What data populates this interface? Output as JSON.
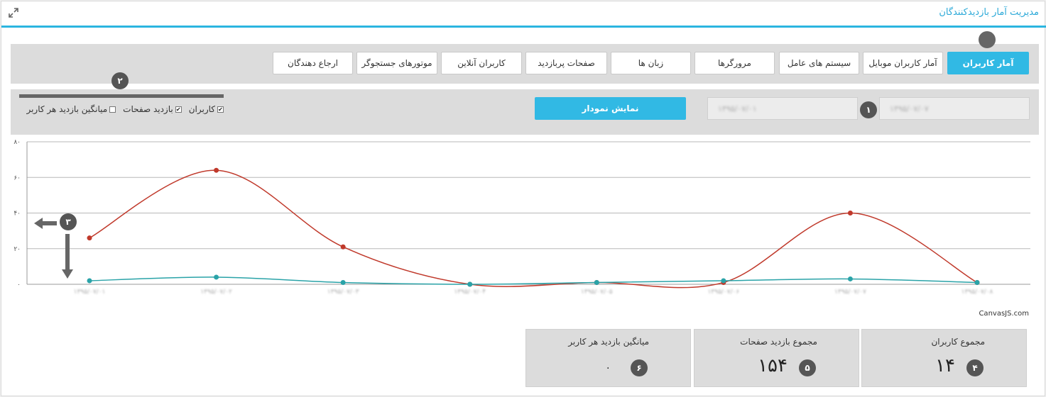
{
  "header": {
    "title": "مدیریت آمار بازدیدکنندگان"
  },
  "tabs": [
    {
      "label": "آمار کاربران",
      "active": true
    },
    {
      "label": "آمار کاربران موبایل",
      "active": false
    },
    {
      "label": "سیستم های عامل",
      "active": false
    },
    {
      "label": "مرورگرها",
      "active": false
    },
    {
      "label": "زبان ها",
      "active": false
    },
    {
      "label": "صفحات پربازدید",
      "active": false
    },
    {
      "label": "کاربران آنلاین",
      "active": false
    },
    {
      "label": "موتورهای جستجوگر",
      "active": false
    },
    {
      "label": "ارجاع دهندگان",
      "active": false
    }
  ],
  "filters": {
    "date_from": "۱۳۹۵/۰۷/۰۷",
    "date_to": "۱۳۹۵/۰۷/۰۱",
    "show_button": "نمایش نمودار",
    "checkboxes": [
      {
        "label": "کاربران",
        "checked": true
      },
      {
        "label": "بازدید صفحات",
        "checked": true
      },
      {
        "label": "میانگین بازدید هر کاربر",
        "checked": false
      }
    ]
  },
  "badges": {
    "b1": "۱",
    "b2": "۲",
    "b3": "۳",
    "b4": "۴",
    "b5": "۵",
    "b6": "۶"
  },
  "chart_data": {
    "type": "line",
    "ylim": [
      0,
      80
    ],
    "y_ticks": [
      "۰",
      "۲۰",
      "۴۰",
      "۶۰",
      "۸۰"
    ],
    "categories": [
      "۱۳۹۵/۰۷/۰۱",
      "۱۳۹۵/۰۷/۰۲",
      "۱۳۹۵/۰۷/۰۳",
      "۱۳۹۵/۰۷/۰۴",
      "۱۳۹۵/۰۷/۰۵",
      "۱۳۹۵/۰۷/۰۶",
      "۱۳۹۵/۰۷/۰۷",
      "۱۳۹۵/۰۷/۰۸"
    ],
    "series": [
      {
        "color": "#c0392b",
        "values": [
          26,
          64,
          21,
          0,
          1,
          1,
          40,
          1
        ]
      },
      {
        "color": "#2aa3a8",
        "values": [
          2,
          4,
          1,
          0,
          1,
          2,
          3,
          1
        ]
      }
    ],
    "credit": "CanvasJS.com"
  },
  "stats": [
    {
      "label": "مجموع کاربران",
      "value": "۱۴"
    },
    {
      "label": "مجموع بازدید صفحات",
      "value": "۱۵۴"
    },
    {
      "label": "میانگین بازدید هر کاربر",
      "value": "۰"
    }
  ]
}
